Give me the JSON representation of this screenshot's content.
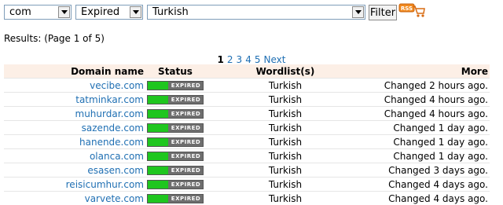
{
  "filters": {
    "tld": "com",
    "status": "Expired",
    "wordlist": "Turkish",
    "button": "Filter",
    "rss_badge": "RSS",
    "rss_icon": "rss-cart-icon"
  },
  "results": {
    "label": "Results: (Page 1 of 5)"
  },
  "pager": {
    "current": "1",
    "pages": [
      "2",
      "3",
      "4",
      "5"
    ],
    "next": "Next"
  },
  "table": {
    "headers": {
      "domain": "Domain name",
      "status": "Status",
      "wordlists": "Wordlist(s)",
      "more": "More"
    },
    "status_badge_text": "EXPIRED",
    "colors": {
      "badge_green": "#1fc61f",
      "badge_gray": "#6e6e6e",
      "header_bg": "#fcefe6",
      "link": "#1f6fb3"
    },
    "rows": [
      {
        "domain": "vecibe.com",
        "wordlist": "Turkish",
        "more": "Changed 2 hours ago."
      },
      {
        "domain": "tatminkar.com",
        "wordlist": "Turkish",
        "more": "Changed 4 hours ago."
      },
      {
        "domain": "muhurdar.com",
        "wordlist": "Turkish",
        "more": "Changed 4 hours ago."
      },
      {
        "domain": "sazende.com",
        "wordlist": "Turkish",
        "more": "Changed 1 day ago."
      },
      {
        "domain": "hanende.com",
        "wordlist": "Turkish",
        "more": "Changed 1 day ago."
      },
      {
        "domain": "olanca.com",
        "wordlist": "Turkish",
        "more": "Changed 1 day ago."
      },
      {
        "domain": "esasen.com",
        "wordlist": "Turkish",
        "more": "Changed 3 days ago."
      },
      {
        "domain": "reisicumhur.com",
        "wordlist": "Turkish",
        "more": "Changed 4 days ago."
      },
      {
        "domain": "varvete.com",
        "wordlist": "Turkish",
        "more": "Changed 4 days ago."
      }
    ]
  }
}
